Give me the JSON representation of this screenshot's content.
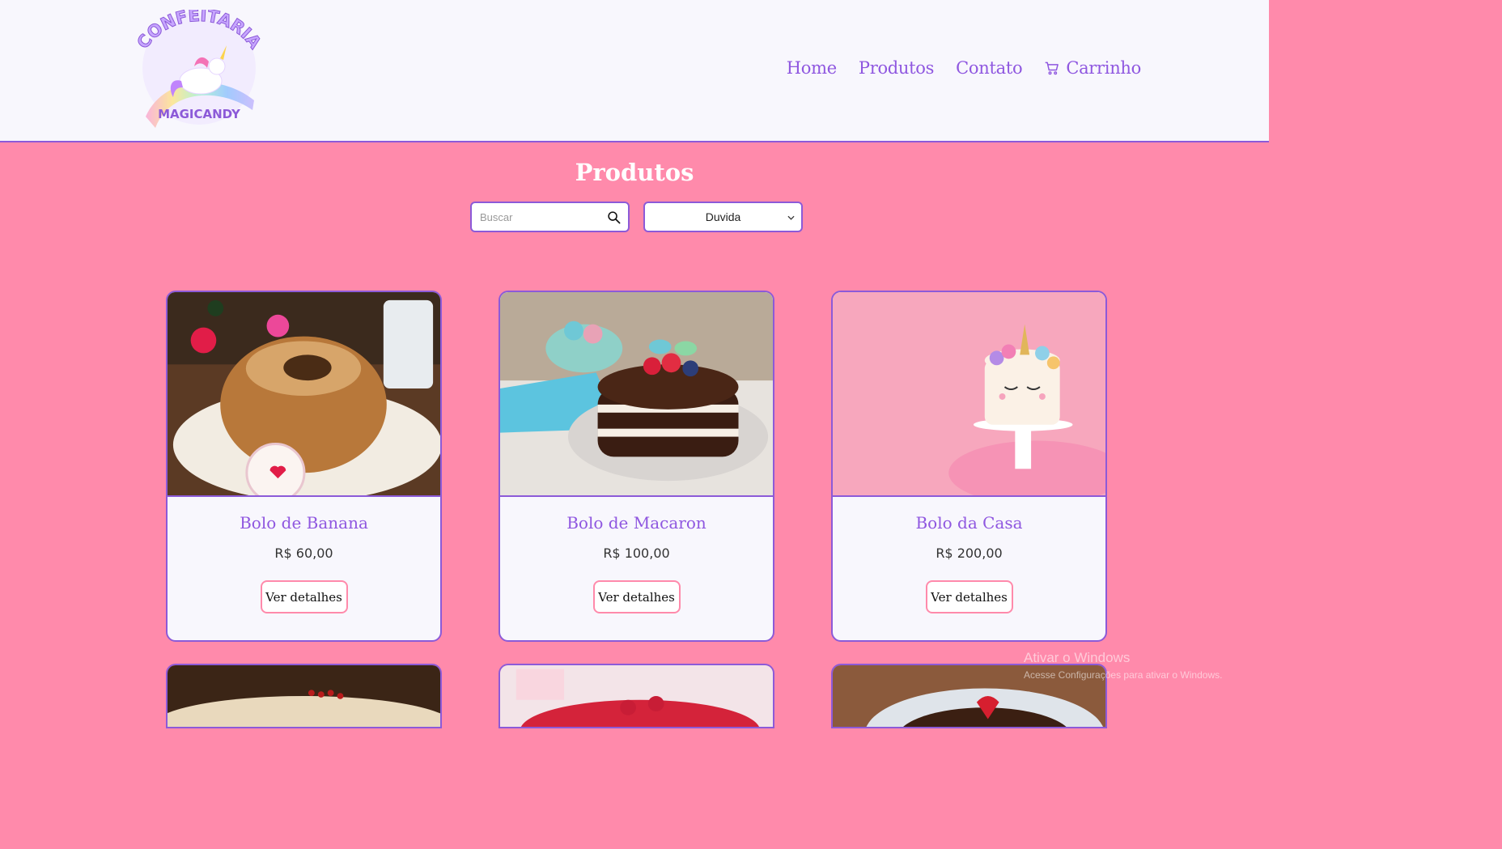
{
  "brand": {
    "logo_text_top": "CONFEITARIA",
    "logo_text_bottom": "MAGICANDY"
  },
  "nav": {
    "items": [
      {
        "label": "Home"
      },
      {
        "label": "Produtos"
      },
      {
        "label": "Contato"
      },
      {
        "label": "Carrinho",
        "icon": "cart-icon"
      }
    ]
  },
  "page": {
    "title": "Produtos"
  },
  "search": {
    "placeholder": "Buscar",
    "value": "",
    "icon": "search-icon"
  },
  "filter": {
    "selected": "Duvida"
  },
  "products": [
    {
      "name": "Bolo de Banana",
      "price": "R$ 60,00",
      "button": "Ver detalhes"
    },
    {
      "name": "Bolo de Macaron",
      "price": "R$ 100,00",
      "button": "Ver detalhes"
    },
    {
      "name": "Bolo da Casa",
      "price": "R$ 200,00",
      "button": "Ver detalhes"
    }
  ],
  "os_watermark": {
    "line1": "Ativar o Windows",
    "line2": "Acesse Configurações para ativar o Windows."
  },
  "colors": {
    "background": "#ff8aab",
    "navbar": "#f8f7fd",
    "accent": "#8c5ad8",
    "link": "#8f57e0"
  }
}
